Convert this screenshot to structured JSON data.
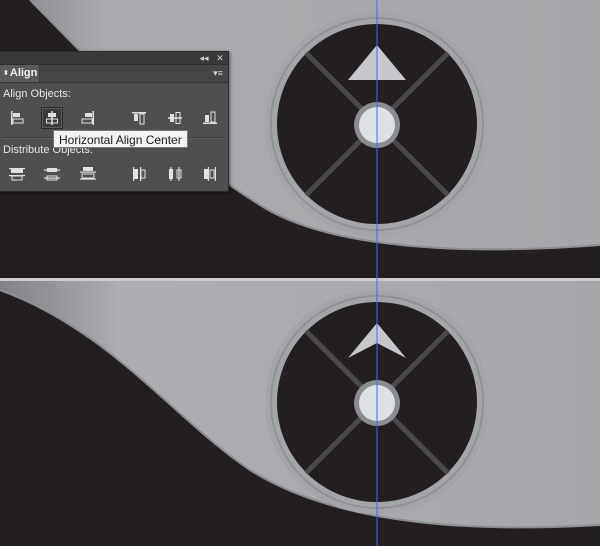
{
  "panel": {
    "title": "Align",
    "collapse_glyph": "◂◂",
    "close_glyph": "✕",
    "menu_glyph": "▾≡",
    "tab_arrows": "⬍",
    "align_objects_label": "Align Objects:",
    "distribute_objects_label": "Distribute Objects:",
    "align_buttons": [
      {
        "name": "horizontal-align-left",
        "icon": "align-left-icon",
        "active": false
      },
      {
        "name": "horizontal-align-center",
        "icon": "align-horizontal-center-icon",
        "active": true
      },
      {
        "name": "horizontal-align-right",
        "icon": "align-right-icon",
        "active": false
      },
      {
        "name": "vertical-align-top",
        "icon": "align-top-icon",
        "active": false
      },
      {
        "name": "vertical-align-center",
        "icon": "align-vertical-center-icon",
        "active": false
      },
      {
        "name": "vertical-align-bottom",
        "icon": "align-bottom-icon",
        "active": false
      }
    ],
    "distribute_buttons": [
      {
        "name": "vertical-distribute-top",
        "icon": "distribute-top-icon"
      },
      {
        "name": "vertical-distribute-center",
        "icon": "distribute-vertical-center-icon"
      },
      {
        "name": "vertical-distribute-bottom",
        "icon": "distribute-bottom-icon"
      },
      {
        "name": "horizontal-distribute-left",
        "icon": "distribute-left-icon"
      },
      {
        "name": "horizontal-distribute-center",
        "icon": "distribute-horizontal-center-icon"
      },
      {
        "name": "horizontal-distribute-right",
        "icon": "distribute-right-icon"
      }
    ]
  },
  "tooltip": {
    "text": "Horizontal Align Center"
  },
  "colors": {
    "background": "#231f20",
    "wave_light": "#b4b6b9",
    "wave_dark": "#8e9093",
    "ring_outer": "#a1a3a6",
    "ring_inner": "#8a8c8f",
    "circle_fill": "#231f20",
    "spokes": "#4b4a4c",
    "hub": "#dde0e3",
    "arrow": "#c4c6c9",
    "guide_line": "#3b6bff",
    "panel_bg": "#4f4f4f"
  }
}
